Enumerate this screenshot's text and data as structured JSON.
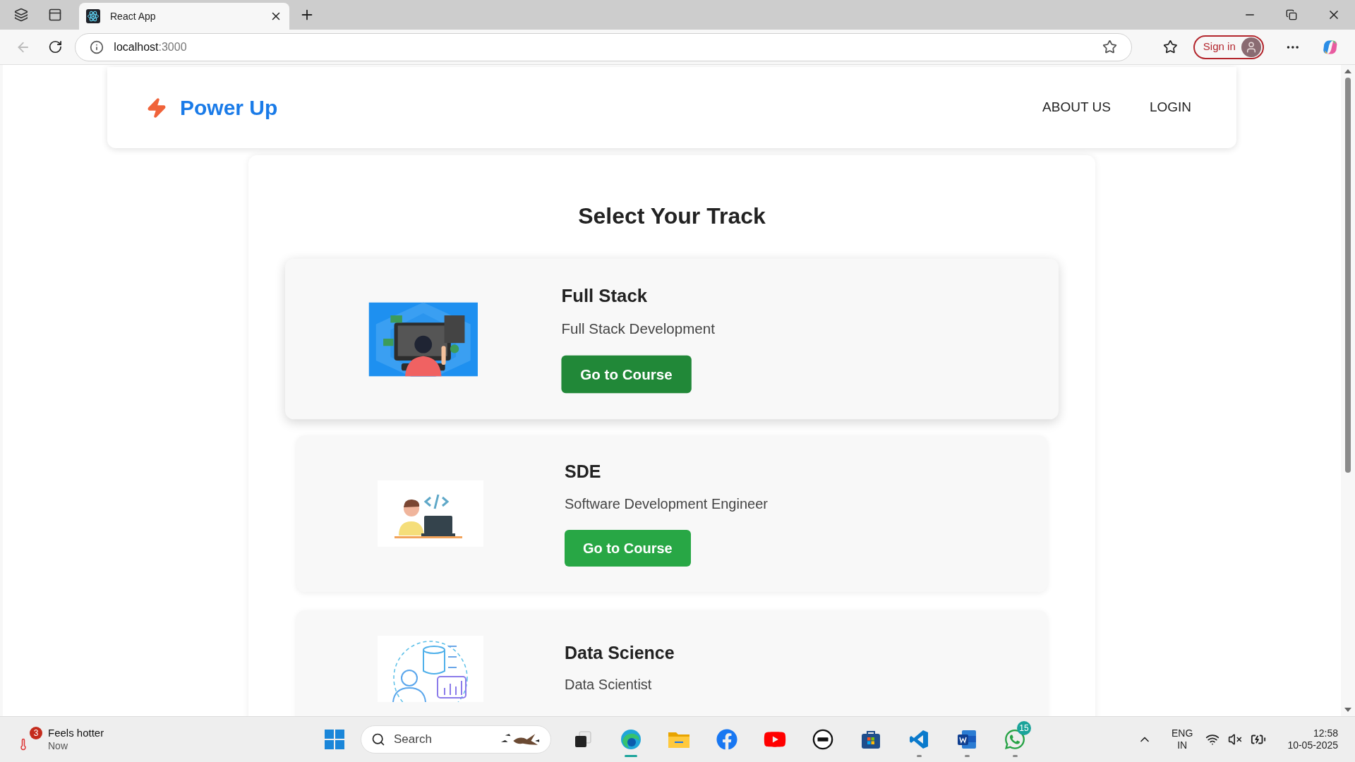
{
  "browser": {
    "tab_title": "React App",
    "address_host": "localhost",
    "address_port": ":3000",
    "sign_in": "Sign in"
  },
  "navbar": {
    "brand": "Power Up",
    "links": [
      {
        "label": "ABOUT US"
      },
      {
        "label": "LOGIN"
      }
    ]
  },
  "heading": "Select Your Track",
  "tracks": [
    {
      "title": "Full Stack",
      "subtitle": "Full Stack Development",
      "button": "Go to Course",
      "hovered": true
    },
    {
      "title": "SDE",
      "subtitle": "Software Development Engineer",
      "button": "Go to Course",
      "hovered": false
    },
    {
      "title": "Data Science",
      "subtitle": "Data Scientist",
      "hovered": false
    }
  ],
  "taskbar": {
    "weather": {
      "badge": "3",
      "title": "Feels hotter",
      "subtitle": "Now"
    },
    "search": {
      "placeholder": "Search"
    },
    "apps": [
      {
        "kind": "taskview",
        "open": false,
        "selected": false
      },
      {
        "kind": "edge",
        "open": true,
        "selected": true
      },
      {
        "kind": "folder",
        "open": false,
        "selected": false
      },
      {
        "kind": "facebook",
        "open": false,
        "selected": false
      },
      {
        "kind": "youtube",
        "open": false,
        "selected": false
      },
      {
        "kind": "dell",
        "open": false,
        "selected": false
      },
      {
        "kind": "store",
        "open": false,
        "selected": false
      },
      {
        "kind": "vscode",
        "open": true,
        "selected": false
      },
      {
        "kind": "word",
        "open": true,
        "selected": false
      },
      {
        "kind": "whatsapp",
        "open": true,
        "selected": false,
        "badge": "15"
      }
    ],
    "tray": {
      "language": "ENG",
      "region": "IN",
      "time": "12:58",
      "date": "10-05-2025"
    }
  }
}
